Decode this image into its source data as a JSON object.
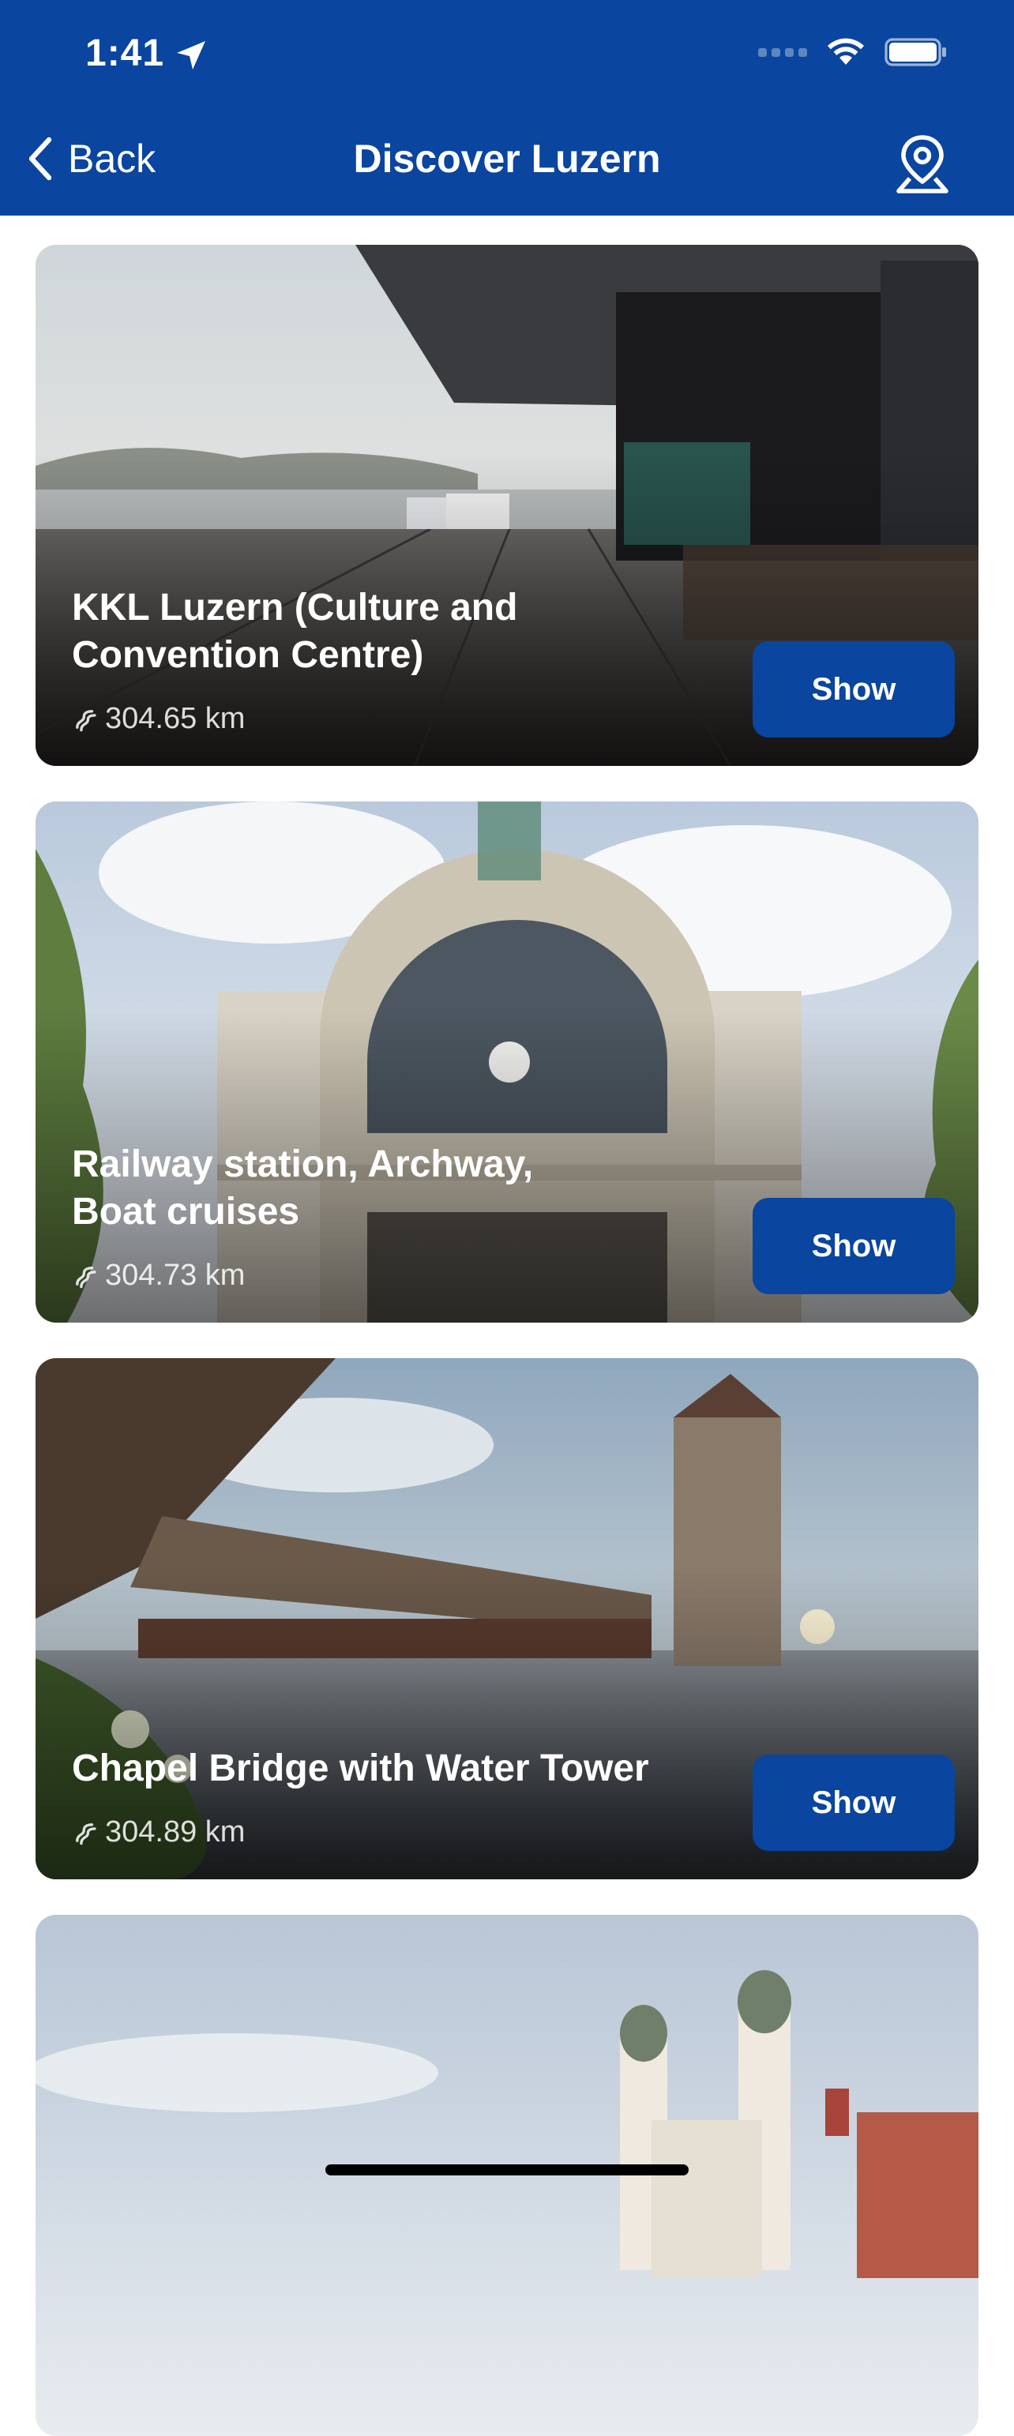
{
  "status_bar": {
    "time": "1:41"
  },
  "nav": {
    "back_label": "Back",
    "title": "Discover Luzern"
  },
  "icons": {
    "back": "chevron-left-icon",
    "map": "map-pin-icon",
    "location": "location-arrow-icon",
    "wifi": "wifi-icon",
    "battery": "battery-icon",
    "distance": "route-icon"
  },
  "colors": {
    "brand": "#0A459F",
    "on_brand": "#FFFFFF"
  },
  "places": [
    {
      "title": "KKL Luzern (Culture and Convention Centre)",
      "distance": "304.65 km",
      "action_label": "Show"
    },
    {
      "title": "Railway station, Archway, Boat cruises",
      "distance": "304.73 km",
      "action_label": "Show"
    },
    {
      "title": "Chapel Bridge with Water Tower",
      "distance": "304.89 km",
      "action_label": "Show"
    },
    {
      "title": "",
      "distance": "",
      "action_label": ""
    }
  ]
}
